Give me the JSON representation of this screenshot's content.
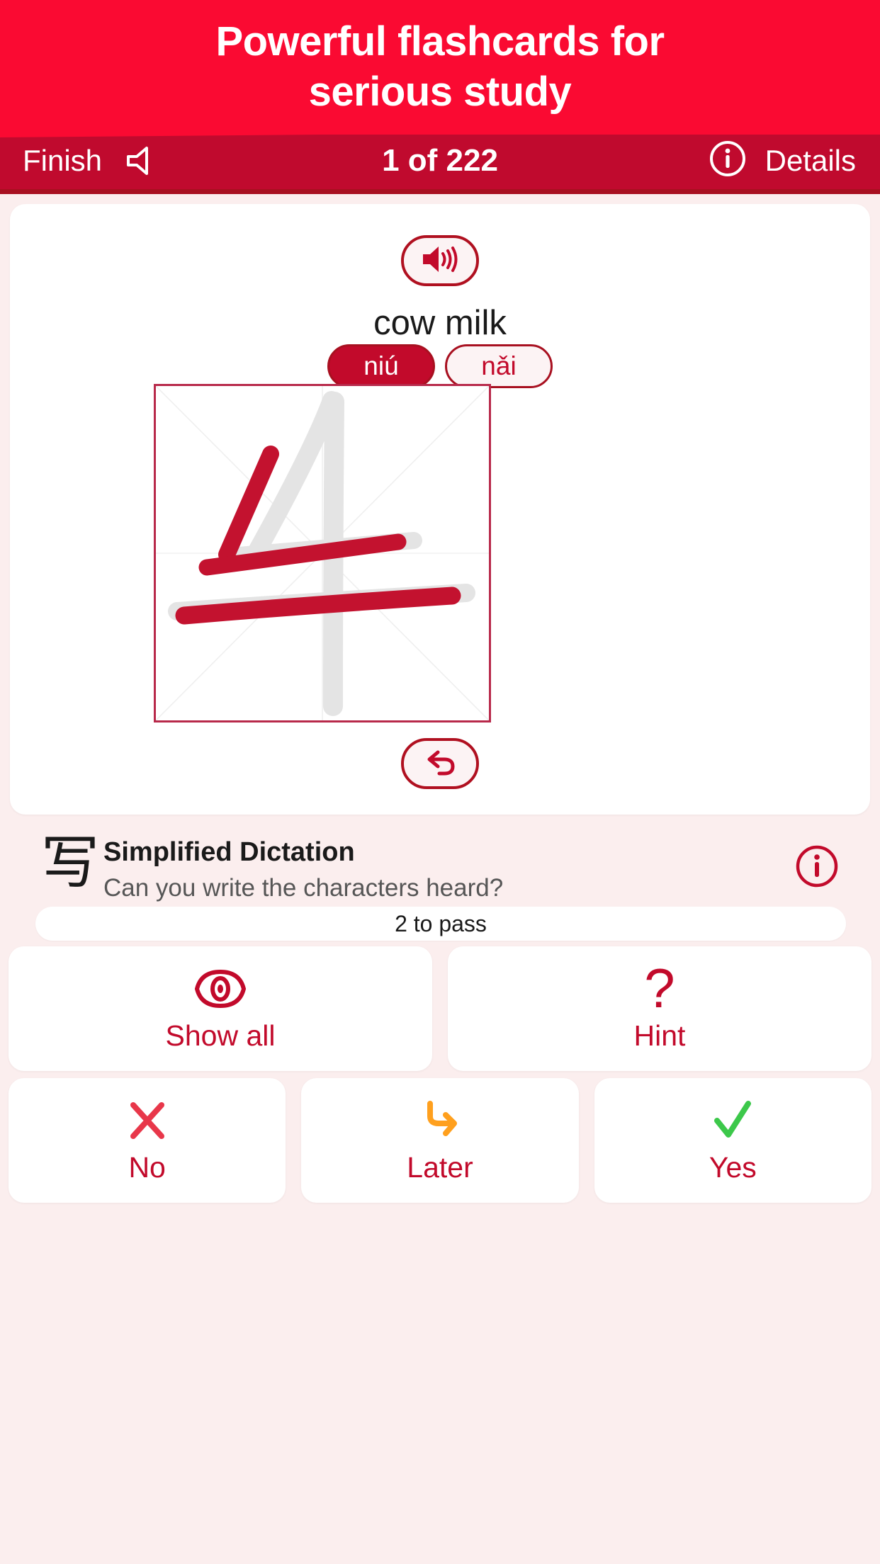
{
  "colors": {
    "promo_bg": "#FA0A32",
    "nav_bg": "#C00A2E",
    "page_bg": "#FBEEEE",
    "card_bg": "#FFFFFF",
    "accent_red": "#C20A2B",
    "dark_red": "#A81020",
    "grid_border": "#B8294A",
    "stroke_red": "#C3122F",
    "ghost_gray": "#E4E4E4",
    "later_orange": "#FFA01E",
    "yes_green": "#3CC84A",
    "no_red": "#E8374A"
  },
  "promo": {
    "line1": "Powerful flashcards for",
    "line2": "serious study"
  },
  "navbar": {
    "finish_label": "Finish",
    "speaker_icon": "speaker-mute-icon",
    "counter": "1 of 222",
    "info_icon": "info-circle-icon",
    "details_label": "Details"
  },
  "card": {
    "audio_button": {
      "icon": "speaker-volume-icon"
    },
    "meaning": "cow milk",
    "pinyin": [
      {
        "label": "niú",
        "selected": true
      },
      {
        "label": "nǎi",
        "selected": false
      }
    ],
    "character": "牛",
    "undo_button": {
      "icon": "undo-arrow-icon"
    }
  },
  "task": {
    "glyph": "写",
    "title": "Simplified Dictation",
    "subtitle": "Can you write the characters heard?",
    "info_icon": "info-circle-icon",
    "pass_text": "2 to pass"
  },
  "actions_row1": [
    {
      "label": "Show all",
      "icon": "eye-icon"
    },
    {
      "label": "Hint",
      "icon": "question-mark-icon"
    }
  ],
  "actions_row2": [
    {
      "label": "No",
      "icon": "cross-icon"
    },
    {
      "label": "Later",
      "icon": "arrow-turn-right-icon"
    },
    {
      "label": "Yes",
      "icon": "check-icon"
    }
  ]
}
